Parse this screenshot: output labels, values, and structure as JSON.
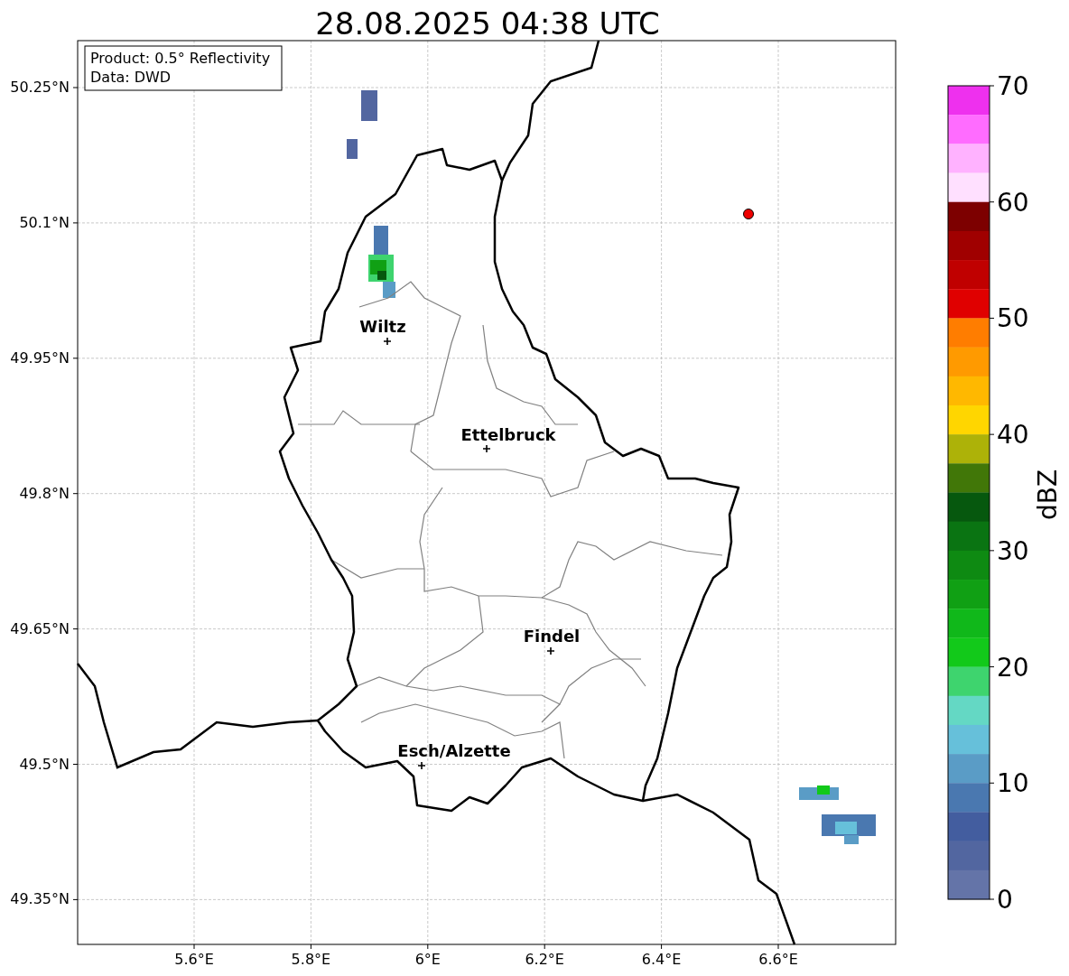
{
  "title": "28.08.2025 04:38 UTC",
  "info_box": [
    "Product: 0.5° Reflectivity",
    "Data: DWD"
  ],
  "map": {
    "lat_labels": [
      "50.25°N",
      "50.1°N",
      "49.95°N",
      "49.8°N",
      "49.65°N",
      "49.5°N",
      "49.35°N"
    ],
    "lon_labels": [
      "5.6°E",
      "5.8°E",
      "6°E",
      "6.2°E",
      "6.4°E",
      "6.6°E"
    ],
    "cities": [
      {
        "name": "Wiltz"
      },
      {
        "name": "Ettelbruck"
      },
      {
        "name": "Findel"
      },
      {
        "name": "Esch/Alzette"
      }
    ]
  },
  "colorbar": {
    "label": "dBZ",
    "ticks": [
      "70",
      "60",
      "50",
      "40",
      "30",
      "20",
      "10",
      "0"
    ],
    "segments": [
      {
        "color": "#ee30ee"
      },
      {
        "color": "#ff6cff"
      },
      {
        "color": "#ffb2ff"
      },
      {
        "color": "#ffe0ff"
      },
      {
        "color": "#7d0000"
      },
      {
        "color": "#a00000"
      },
      {
        "color": "#c00000"
      },
      {
        "color": "#e00000"
      },
      {
        "color": "#ff7d00"
      },
      {
        "color": "#ff9a00"
      },
      {
        "color": "#ffb800"
      },
      {
        "color": "#ffd600"
      },
      {
        "color": "#adb208"
      },
      {
        "color": "#417708"
      },
      {
        "color": "#06580e"
      },
      {
        "color": "#0a7412"
      },
      {
        "color": "#0e8a12"
      },
      {
        "color": "#10a014"
      },
      {
        "color": "#10b81a"
      },
      {
        "color": "#12c91a"
      },
      {
        "color": "#3ed46e"
      },
      {
        "color": "#64d8c4"
      },
      {
        "color": "#66c0da"
      },
      {
        "color": "#5a9cc6"
      },
      {
        "color": "#4a78b0"
      },
      {
        "color": "#435d9f"
      },
      {
        "color": "#5266a0"
      },
      {
        "color": "#6474a8"
      }
    ]
  }
}
